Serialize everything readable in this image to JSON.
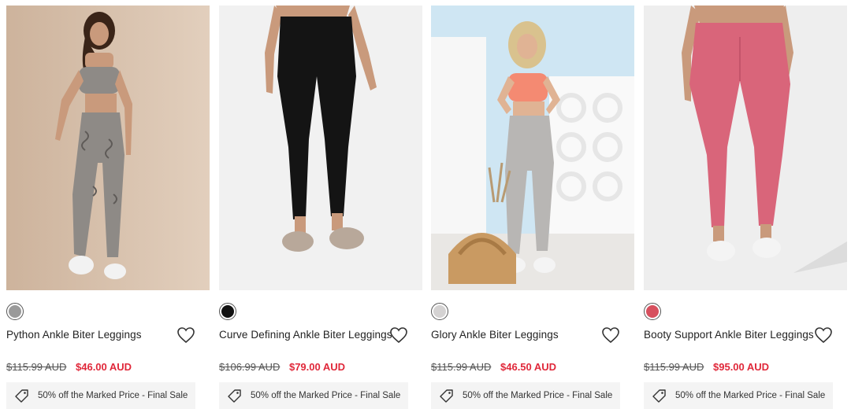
{
  "products": [
    {
      "name": "Python Ankle Biter Leggings",
      "was_price": "$115.99 AUD",
      "price": "$46.00 AUD",
      "promo": "50% off the Marked Price - Final Sale",
      "swatch_color": "#9a9a9a",
      "photo_bg": "#d9c3ae",
      "garment_color": "#8e8a86",
      "icon_wishlist": "heart-icon",
      "icon_promo": "tag-icon"
    },
    {
      "name": "Curve Defining Ankle Biter Leggings",
      "was_price": "$106.99 AUD",
      "price": "$79.00 AUD",
      "promo": "50% off the Marked Price - Final Sale",
      "swatch_color": "#111111",
      "photo_bg": "#f2f2f2",
      "garment_color": "#151515",
      "icon_wishlist": "heart-icon",
      "icon_promo": "tag-icon"
    },
    {
      "name": "Glory Ankle Biter Leggings",
      "was_price": "$115.99 AUD",
      "price": "$46.50 AUD",
      "promo": "50% off the Marked Price - Final Sale",
      "swatch_color": "#d4d2d2",
      "photo_bg": "#cfe6f3",
      "garment_color": "#b8b6b4",
      "icon_wishlist": "heart-icon",
      "icon_promo": "tag-icon"
    },
    {
      "name": "Booty Support Ankle Biter Leggings",
      "was_price": "$115.99 AUD",
      "price": "$95.00 AUD",
      "promo": "50% off the Marked Price - Final Sale",
      "swatch_color": "#d7505e",
      "photo_bg": "#eeeeee",
      "garment_color": "#d9657a",
      "icon_wishlist": "heart-icon",
      "icon_promo": "tag-icon"
    }
  ],
  "colors": {
    "sale_price": "#e0283a",
    "promo_bg": "#f4f4f4"
  }
}
